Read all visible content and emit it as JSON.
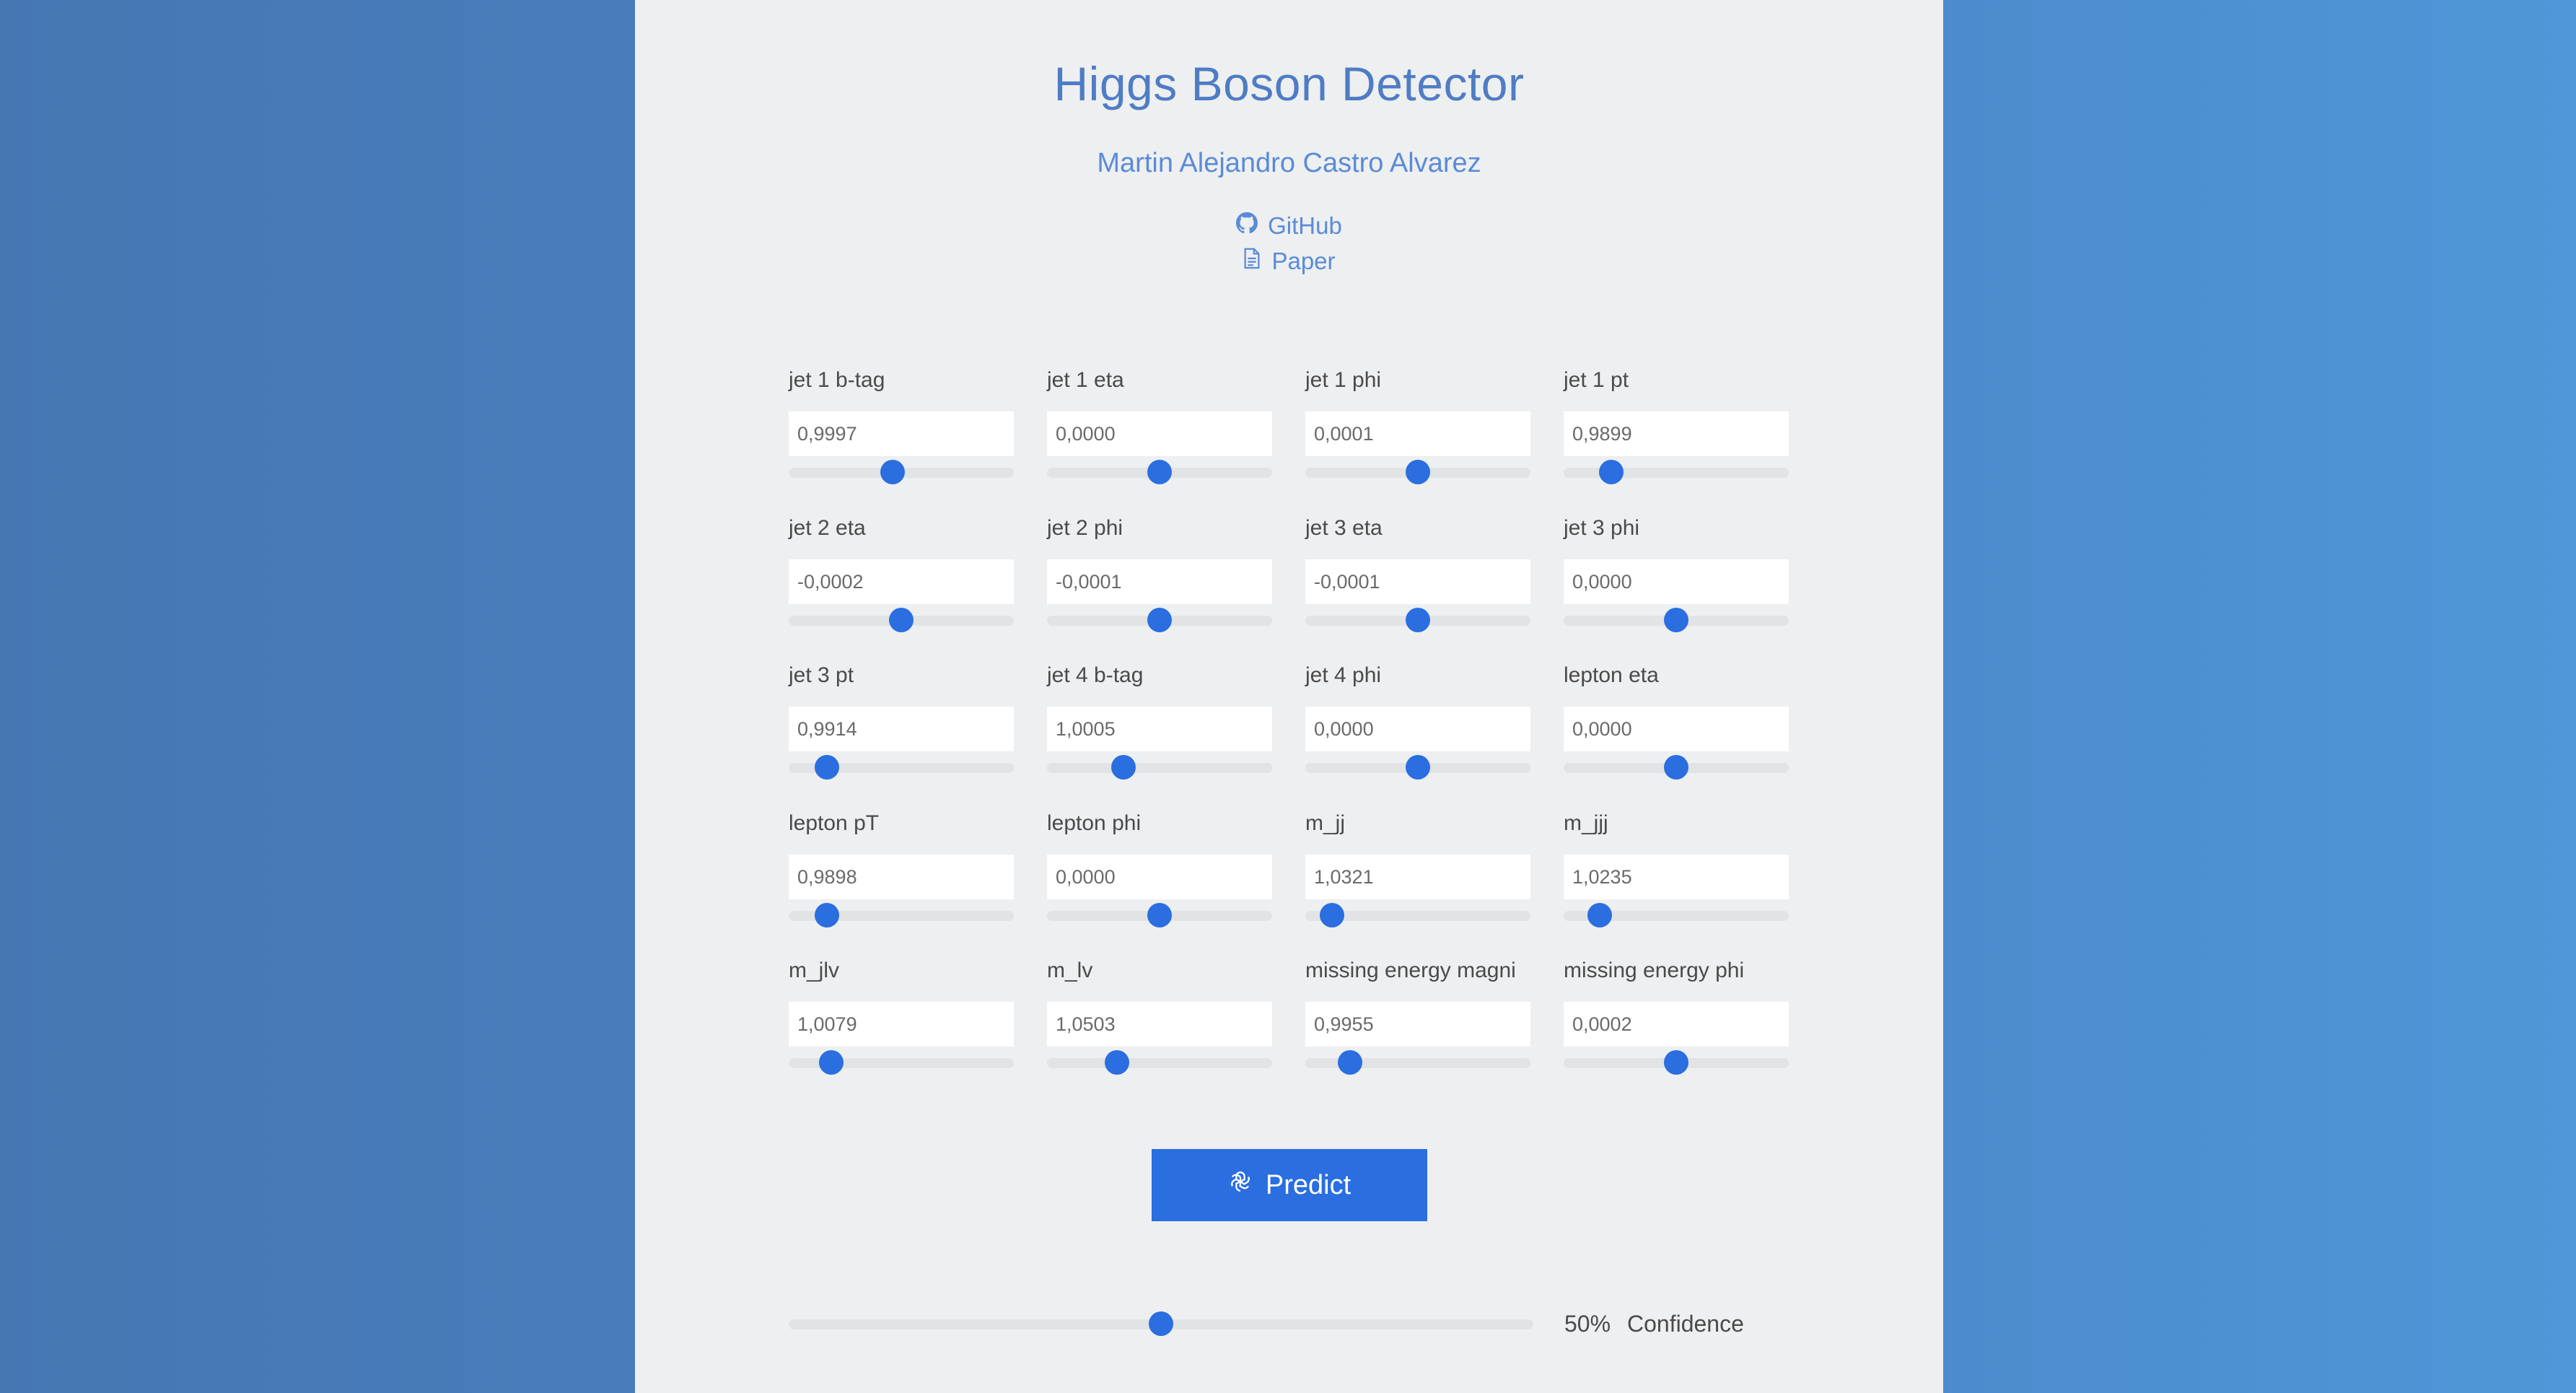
{
  "header": {
    "title": "Higgs Boson Detector",
    "author": "Martin Alejandro Castro Alvarez",
    "github_label": "GitHub",
    "paper_label": "Paper"
  },
  "fields": [
    {
      "label": "jet 1 b-tag",
      "value": "0,9997",
      "slider": 0.46
    },
    {
      "label": "jet 1 eta",
      "value": "0,0000",
      "slider": 0.5
    },
    {
      "label": "jet 1 phi",
      "value": "0,0001",
      "slider": 0.5
    },
    {
      "label": "jet 1 pt",
      "value": "0,9899",
      "slider": 0.21
    },
    {
      "label": "jet 2 eta",
      "value": "-0,0002",
      "slider": 0.5
    },
    {
      "label": "jet 2 phi",
      "value": "-0,0001",
      "slider": 0.5
    },
    {
      "label": "jet 3 eta",
      "value": "-0,0001",
      "slider": 0.5
    },
    {
      "label": "jet 3 phi",
      "value": "0,0000",
      "slider": 0.5
    },
    {
      "label": "jet 3 pt",
      "value": "0,9914",
      "slider": 0.17
    },
    {
      "label": "jet 4 b-tag",
      "value": "1,0005",
      "slider": 0.34
    },
    {
      "label": "jet 4 phi",
      "value": "0,0000",
      "slider": 0.5
    },
    {
      "label": "lepton eta",
      "value": "0,0000",
      "slider": 0.5
    },
    {
      "label": "lepton pT",
      "value": "0,9898",
      "slider": 0.17
    },
    {
      "label": "lepton phi",
      "value": "0,0000",
      "slider": 0.5
    },
    {
      "label": "m_jj",
      "value": "1,0321",
      "slider": 0.12
    },
    {
      "label": "m_jjj",
      "value": "1,0235",
      "slider": 0.16
    },
    {
      "label": "m_jlv",
      "value": "1,0079",
      "slider": 0.19
    },
    {
      "label": "m_lv",
      "value": "1,0503",
      "slider": 0.31
    },
    {
      "label": "missing energy magni",
      "value": "0,9955",
      "slider": 0.2
    },
    {
      "label": "missing energy phi",
      "value": "0,0002",
      "slider": 0.5
    }
  ],
  "predict_label": "Predict",
  "confidence": {
    "value": "50%",
    "label": "Confidence",
    "fraction": 0.5
  },
  "colors": {
    "accent": "#2a6ee0",
    "title": "#4f7cc4",
    "panel": "#edeff0"
  }
}
